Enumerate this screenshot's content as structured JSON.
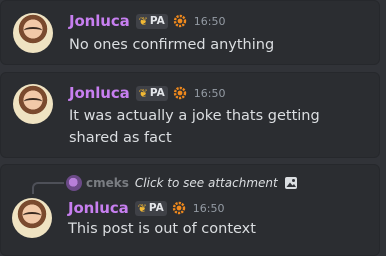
{
  "messages": [
    {
      "author": "Jonluca",
      "tag": "PA",
      "time": "16:50",
      "text": "No ones confirmed anything"
    },
    {
      "author": "Jonluca",
      "tag": "PA",
      "time": "16:50",
      "text": "It was actually a joke thats getting shared as fact"
    },
    {
      "author": "Jonluca",
      "tag": "PA",
      "time": "16:50",
      "text": "This post is out of context",
      "reply": {
        "author": "cmeks",
        "text": "Click to see attachment"
      }
    }
  ],
  "icons": {
    "tag_icon": "leaf-icon",
    "badge_icon": "gear-badge-icon",
    "attachment_icon": "image-icon"
  },
  "colors": {
    "username": "#c77ff0",
    "background": "#313338",
    "message_bg": "#2b2d31",
    "badge": "#f0891c"
  }
}
